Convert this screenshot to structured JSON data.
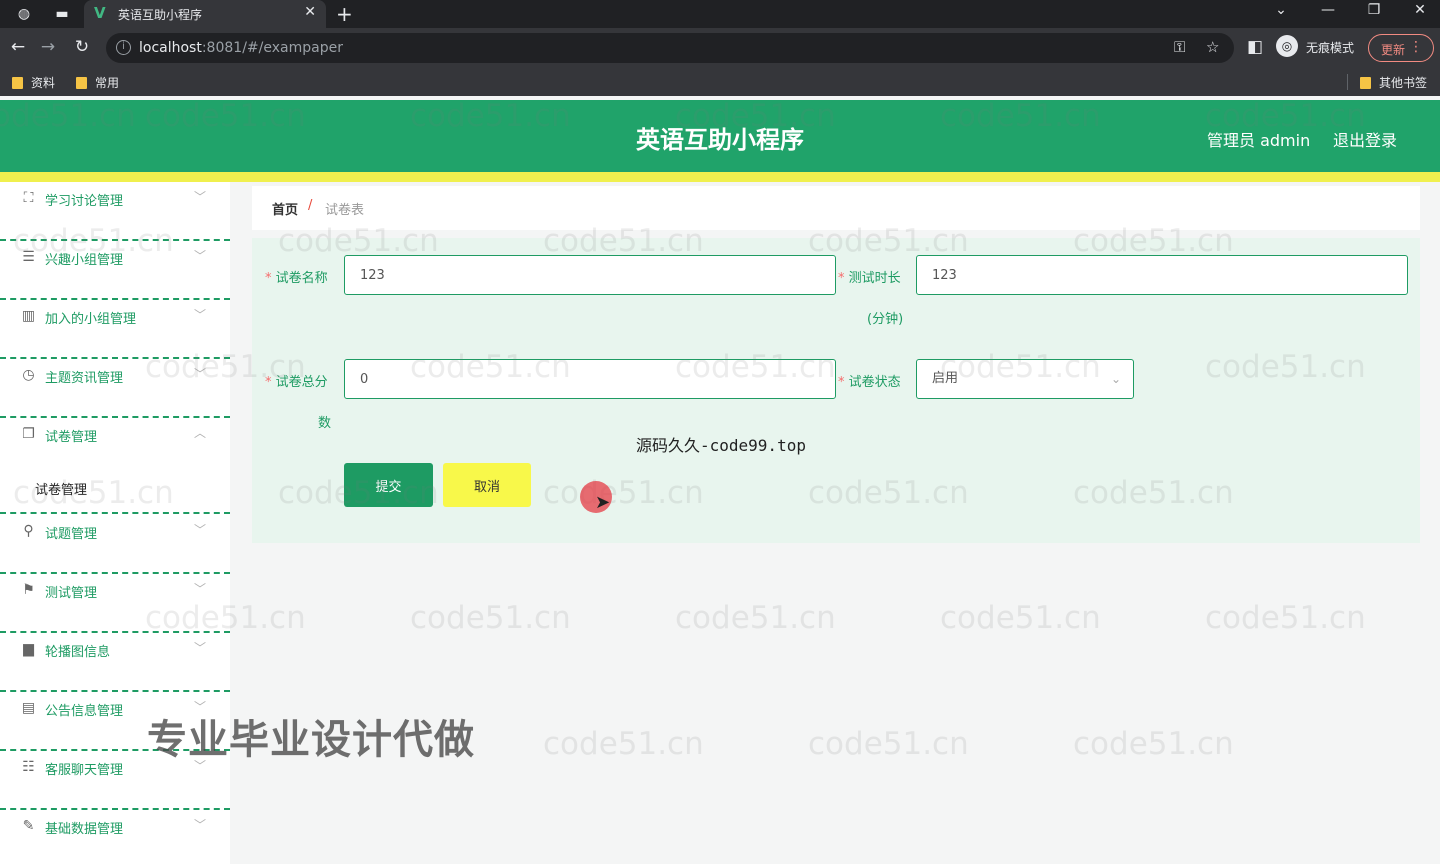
{
  "browser": {
    "tab_title": "英语互助小程序",
    "url_host": "localhost",
    "url_rest": ":8081/#/exampaper",
    "profile_label": "无痕模式",
    "update_label": "更新",
    "bookmarks": [
      "资料",
      "常用"
    ],
    "other_bookmarks": "其他书签"
  },
  "header": {
    "title": "英语互助小程序",
    "user": "管理员 admin",
    "logout": "退出登录"
  },
  "sidebar": {
    "items": [
      {
        "label": "学习讨论管理",
        "icon": "expand-icon",
        "arrow": "﹀"
      },
      {
        "label": "兴趣小组管理",
        "icon": "list-icon",
        "arrow": "﹀"
      },
      {
        "label": "加入的小组管理",
        "icon": "library-icon",
        "arrow": "﹀"
      },
      {
        "label": "主题资讯管理",
        "icon": "clock-icon",
        "arrow": "﹀"
      },
      {
        "label": "试卷管理",
        "icon": "copy-icon",
        "arrow": "︿"
      },
      {
        "label": "试题管理",
        "icon": "pin-icon",
        "arrow": "﹀"
      },
      {
        "label": "测试管理",
        "icon": "flag-icon",
        "arrow": "﹀"
      },
      {
        "label": "轮播图信息",
        "icon": "picture-icon",
        "arrow": "﹀"
      },
      {
        "label": "公告信息管理",
        "icon": "notice-icon",
        "arrow": "﹀"
      },
      {
        "label": "客服聊天管理",
        "icon": "sliders-icon",
        "arrow": "﹀"
      },
      {
        "label": "基础数据管理",
        "icon": "edit-icon",
        "arrow": "﹀"
      }
    ],
    "sub_item": "试卷管理"
  },
  "breadcrumb": {
    "home": "首页",
    "separator": "/",
    "current": "试卷表"
  },
  "form": {
    "name_label": "试卷名称",
    "name_value": "123",
    "duration_label": "测试时长",
    "duration_label_2": "(分钟)",
    "duration_value": "123",
    "score_label": "试卷总分",
    "score_label_2": "数",
    "score_value": "0",
    "status_label": "试卷状态",
    "status_value": "启用",
    "submit": "提交",
    "cancel": "取消"
  },
  "watermarks": {
    "repeat": "code51.cn",
    "source": "源码久久-code99.top",
    "promo": "专业毕业设计代做"
  },
  "colors": {
    "primary": "#20a36a",
    "accent": "#f0f04e",
    "panel": "#e8f5ee"
  }
}
